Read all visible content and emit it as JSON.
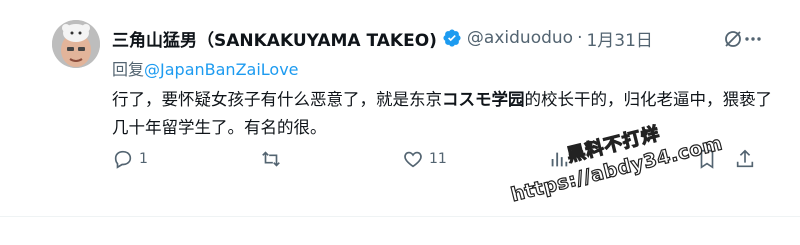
{
  "tweet": {
    "author_name": "三角山猛男（SANKAKUYAMA TAKEO)",
    "handle": "@axiduoduo",
    "separator": "·",
    "date": "1月31日",
    "reply_prefix": "回复",
    "reply_to": "@JapanBanZaiLove",
    "body_parts": [
      "行了，要怀疑女孩子有什么恶意了，就是东京",
      "コスモ学园",
      "的校长干的，归化老逼中，猥亵了几十年留学生了。有名的很。"
    ],
    "reply_count": "1",
    "like_count": "11",
    "icons": {
      "verified": "verified-badge-icon",
      "grok": "grok-icon",
      "more": "more-icon",
      "reply": "reply-icon",
      "retweet": "retweet-icon",
      "like": "heart-icon",
      "views": "views-icon",
      "bookmark": "bookmark-icon",
      "share": "share-icon"
    },
    "colors": {
      "accent": "#1d9bf0",
      "muted": "#536471",
      "text": "#0f1419"
    }
  },
  "watermark": {
    "line1": "黑料不打烊",
    "line2": "https://abdy34.com"
  }
}
